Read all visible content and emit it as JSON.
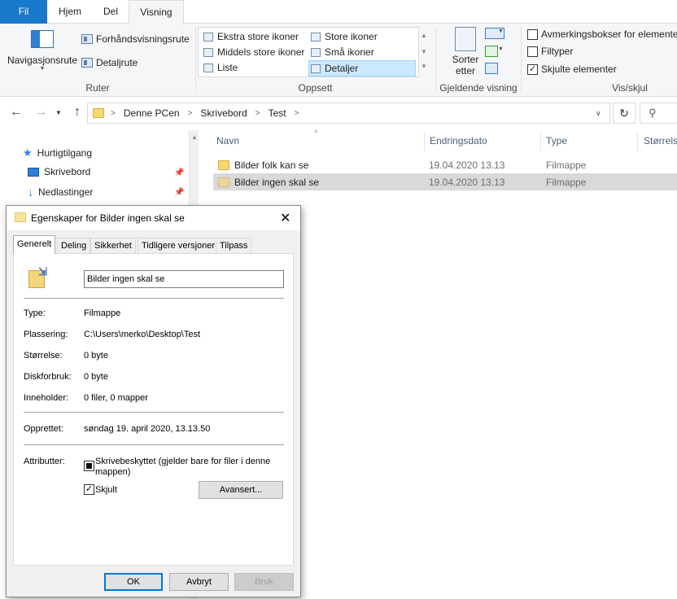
{
  "ribbon": {
    "tabs": [
      "Fil",
      "Hjem",
      "Del",
      "Visning"
    ],
    "nav_pane_button": "Navigasjonsrute",
    "preview_pane": "Forhåndsvisningsrute",
    "details_pane": "Detaljrute",
    "panes_group": "Ruter",
    "layout_items": [
      "Ekstra store ikoner",
      "Store ikoner",
      "Middels store ikoner",
      "Små ikoner",
      "Liste",
      "Detaljer"
    ],
    "layout_group": "Oppsett",
    "sort_button": [
      "Sorter",
      "etter"
    ],
    "current_view_group": "Gjeldende visning",
    "showhide_items": [
      "Avmerkingsbokser for elementer",
      "Filtyper",
      "Skjulte elementer"
    ],
    "showhide_checked": [
      false,
      false,
      true
    ],
    "showhide_group": "Vis/skjul"
  },
  "address": {
    "crumbs": [
      "Denne PCen",
      "Skrivebord",
      "Test"
    ],
    "search_icon_glyph": "⚲"
  },
  "nav": {
    "items": [
      "Hurtigtilgang",
      "Skrivebord",
      "Nedlastinger"
    ]
  },
  "filelist": {
    "columns": [
      "Navn",
      "Endringsdato",
      "Type",
      "Størrelse"
    ],
    "rows": [
      {
        "name": "Bilder folk kan se",
        "date": "19.04.2020 13.13",
        "type": "Filmappe"
      },
      {
        "name": "Bilder ingen skal se",
        "date": "19.04.2020 13.13",
        "type": "Filmappe"
      }
    ]
  },
  "dialog": {
    "title": "Egenskaper for Bilder ingen skal se",
    "tabs": [
      "Generelt",
      "Deling",
      "Sikkerhet",
      "Tidligere versjoner",
      "Tilpass"
    ],
    "folder_name": "Bilder ingen skal se",
    "props": [
      {
        "label": "Type:",
        "value": "Filmappe"
      },
      {
        "label": "Plassering:",
        "value": "C:\\Users\\merko\\Desktop\\Test"
      },
      {
        "label": "Størrelse:",
        "value": "0 byte"
      },
      {
        "label": "Diskforbruk:",
        "value": "0 byte"
      },
      {
        "label": "Inneholder:",
        "value": "0 filer, 0 mapper"
      }
    ],
    "created_label": "Opprettet:",
    "created_value": "søndag 19. april 2020, 13.13.50",
    "attributes_label": "Attributter:",
    "readonly_label": "Skrivebeskyttet (gjelder bare for filer i denne mappen)",
    "hidden_label": "Skjult",
    "hidden_checked": true,
    "advanced_button": "Avansert...",
    "ok_button": "OK",
    "cancel_button": "Avbryt",
    "apply_button": "Bruk"
  },
  "colors": {
    "file_tab": "#1979ca",
    "selection": "#cce8ff",
    "row_selected": "#d9d9d9",
    "folder": "#f8d775"
  }
}
